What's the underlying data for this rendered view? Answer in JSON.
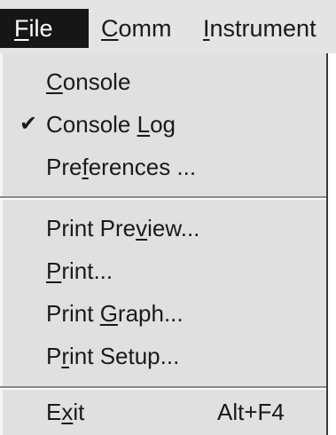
{
  "menubar": {
    "items": [
      {
        "id": "file",
        "prefix": "",
        "accel": "F",
        "rest": "ile",
        "active": true
      },
      {
        "id": "comm",
        "prefix": "",
        "accel": "C",
        "rest": "omm",
        "active": false
      },
      {
        "id": "instrument",
        "prefix": "",
        "accel": "I",
        "rest": "nstrument",
        "active": false
      }
    ]
  },
  "file_menu": {
    "items": [
      {
        "prefix": "",
        "accel": "C",
        "rest": "onsole",
        "checked": false,
        "shortcut": ""
      },
      {
        "prefix": "Console ",
        "accel": "L",
        "rest": "og",
        "checked": true,
        "check_glyph": "✔",
        "shortcut": ""
      },
      {
        "prefix": "Pre",
        "accel": "f",
        "rest": "erences ...",
        "checked": false,
        "shortcut": ""
      },
      {
        "prefix": "Print Pre",
        "accel": "v",
        "rest": "iew...",
        "checked": false,
        "shortcut": ""
      },
      {
        "prefix": "",
        "accel": "P",
        "rest": "rint...",
        "checked": false,
        "shortcut": ""
      },
      {
        "prefix": "Print ",
        "accel": "G",
        "rest": "raph...",
        "checked": false,
        "shortcut": ""
      },
      {
        "prefix": "P",
        "accel": "r",
        "rest": "int Setup...",
        "checked": false,
        "shortcut": ""
      },
      {
        "prefix": "E",
        "accel": "x",
        "rest": "it",
        "checked": false,
        "shortcut": "Alt+F4"
      }
    ]
  }
}
